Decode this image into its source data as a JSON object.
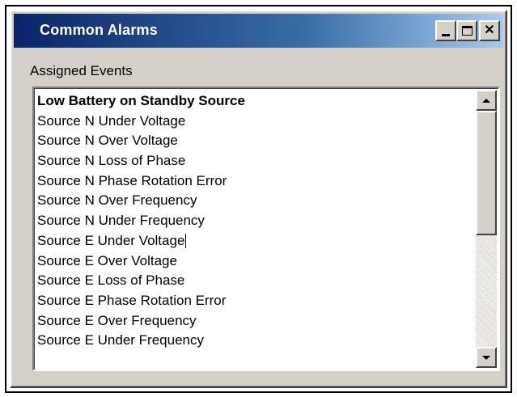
{
  "window": {
    "title": "Common Alarms",
    "minimize_glyph": "_",
    "maximize_glyph": "□",
    "close_glyph": "✕"
  },
  "section": {
    "label": "Assigned Events"
  },
  "events": [
    "Low Battery on Standby Source",
    "Source N Under Voltage",
    "Source N Over Voltage",
    "Source N Loss of Phase",
    "Source N Phase Rotation Error",
    "Source N Over Frequency",
    "Source N Under Frequency",
    "Source E Under Voltage",
    "Source E Over Voltage",
    "Source E Loss of Phase",
    "Source E Phase Rotation Error",
    "Source E Over Frequency",
    "Source E Under Frequency"
  ],
  "scrollbar": {
    "up_icon": "scroll-up-arrow-icon",
    "down_icon": "scroll-down-arrow-icon"
  },
  "colors": {
    "title_gradient_start": "#0a246a",
    "title_gradient_end": "#a6caf0",
    "window_face": "#d4d0c8"
  }
}
